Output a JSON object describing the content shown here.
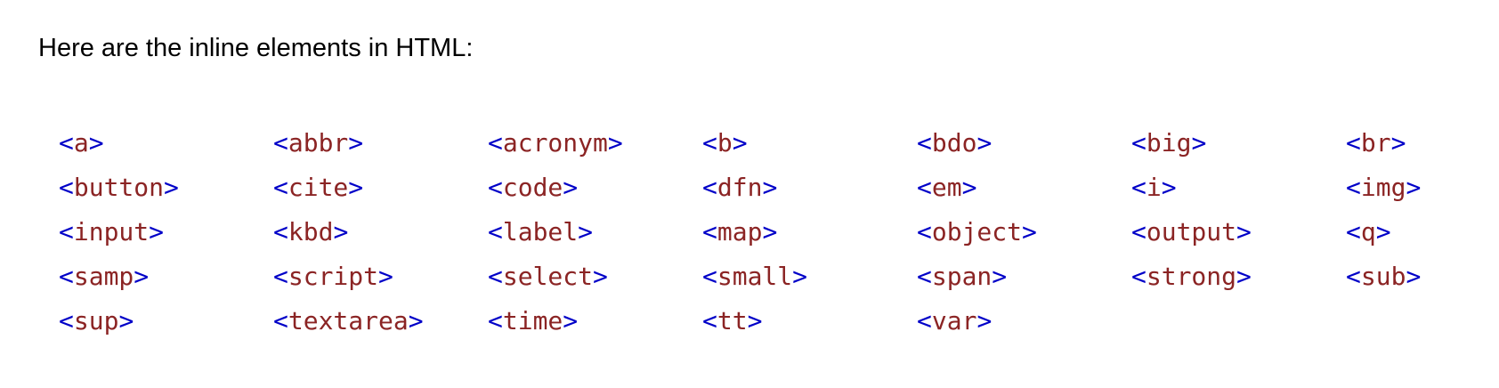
{
  "intro_text": "Here are the inline elements in HTML:",
  "colors": {
    "bracket": "#0000c8",
    "tag_name": "#8b2424"
  },
  "tags": [
    "a",
    "abbr",
    "acronym",
    "b",
    "bdo",
    "big",
    "br",
    "button",
    "cite",
    "code",
    "dfn",
    "em",
    "i",
    "img",
    "input",
    "kbd",
    "label",
    "map",
    "object",
    "output",
    "q",
    "samp",
    "script",
    "select",
    "small",
    "span",
    "strong",
    "sub",
    "sup",
    "textarea",
    "time",
    "tt",
    "var"
  ],
  "bracket_open": "<",
  "bracket_close": ">"
}
